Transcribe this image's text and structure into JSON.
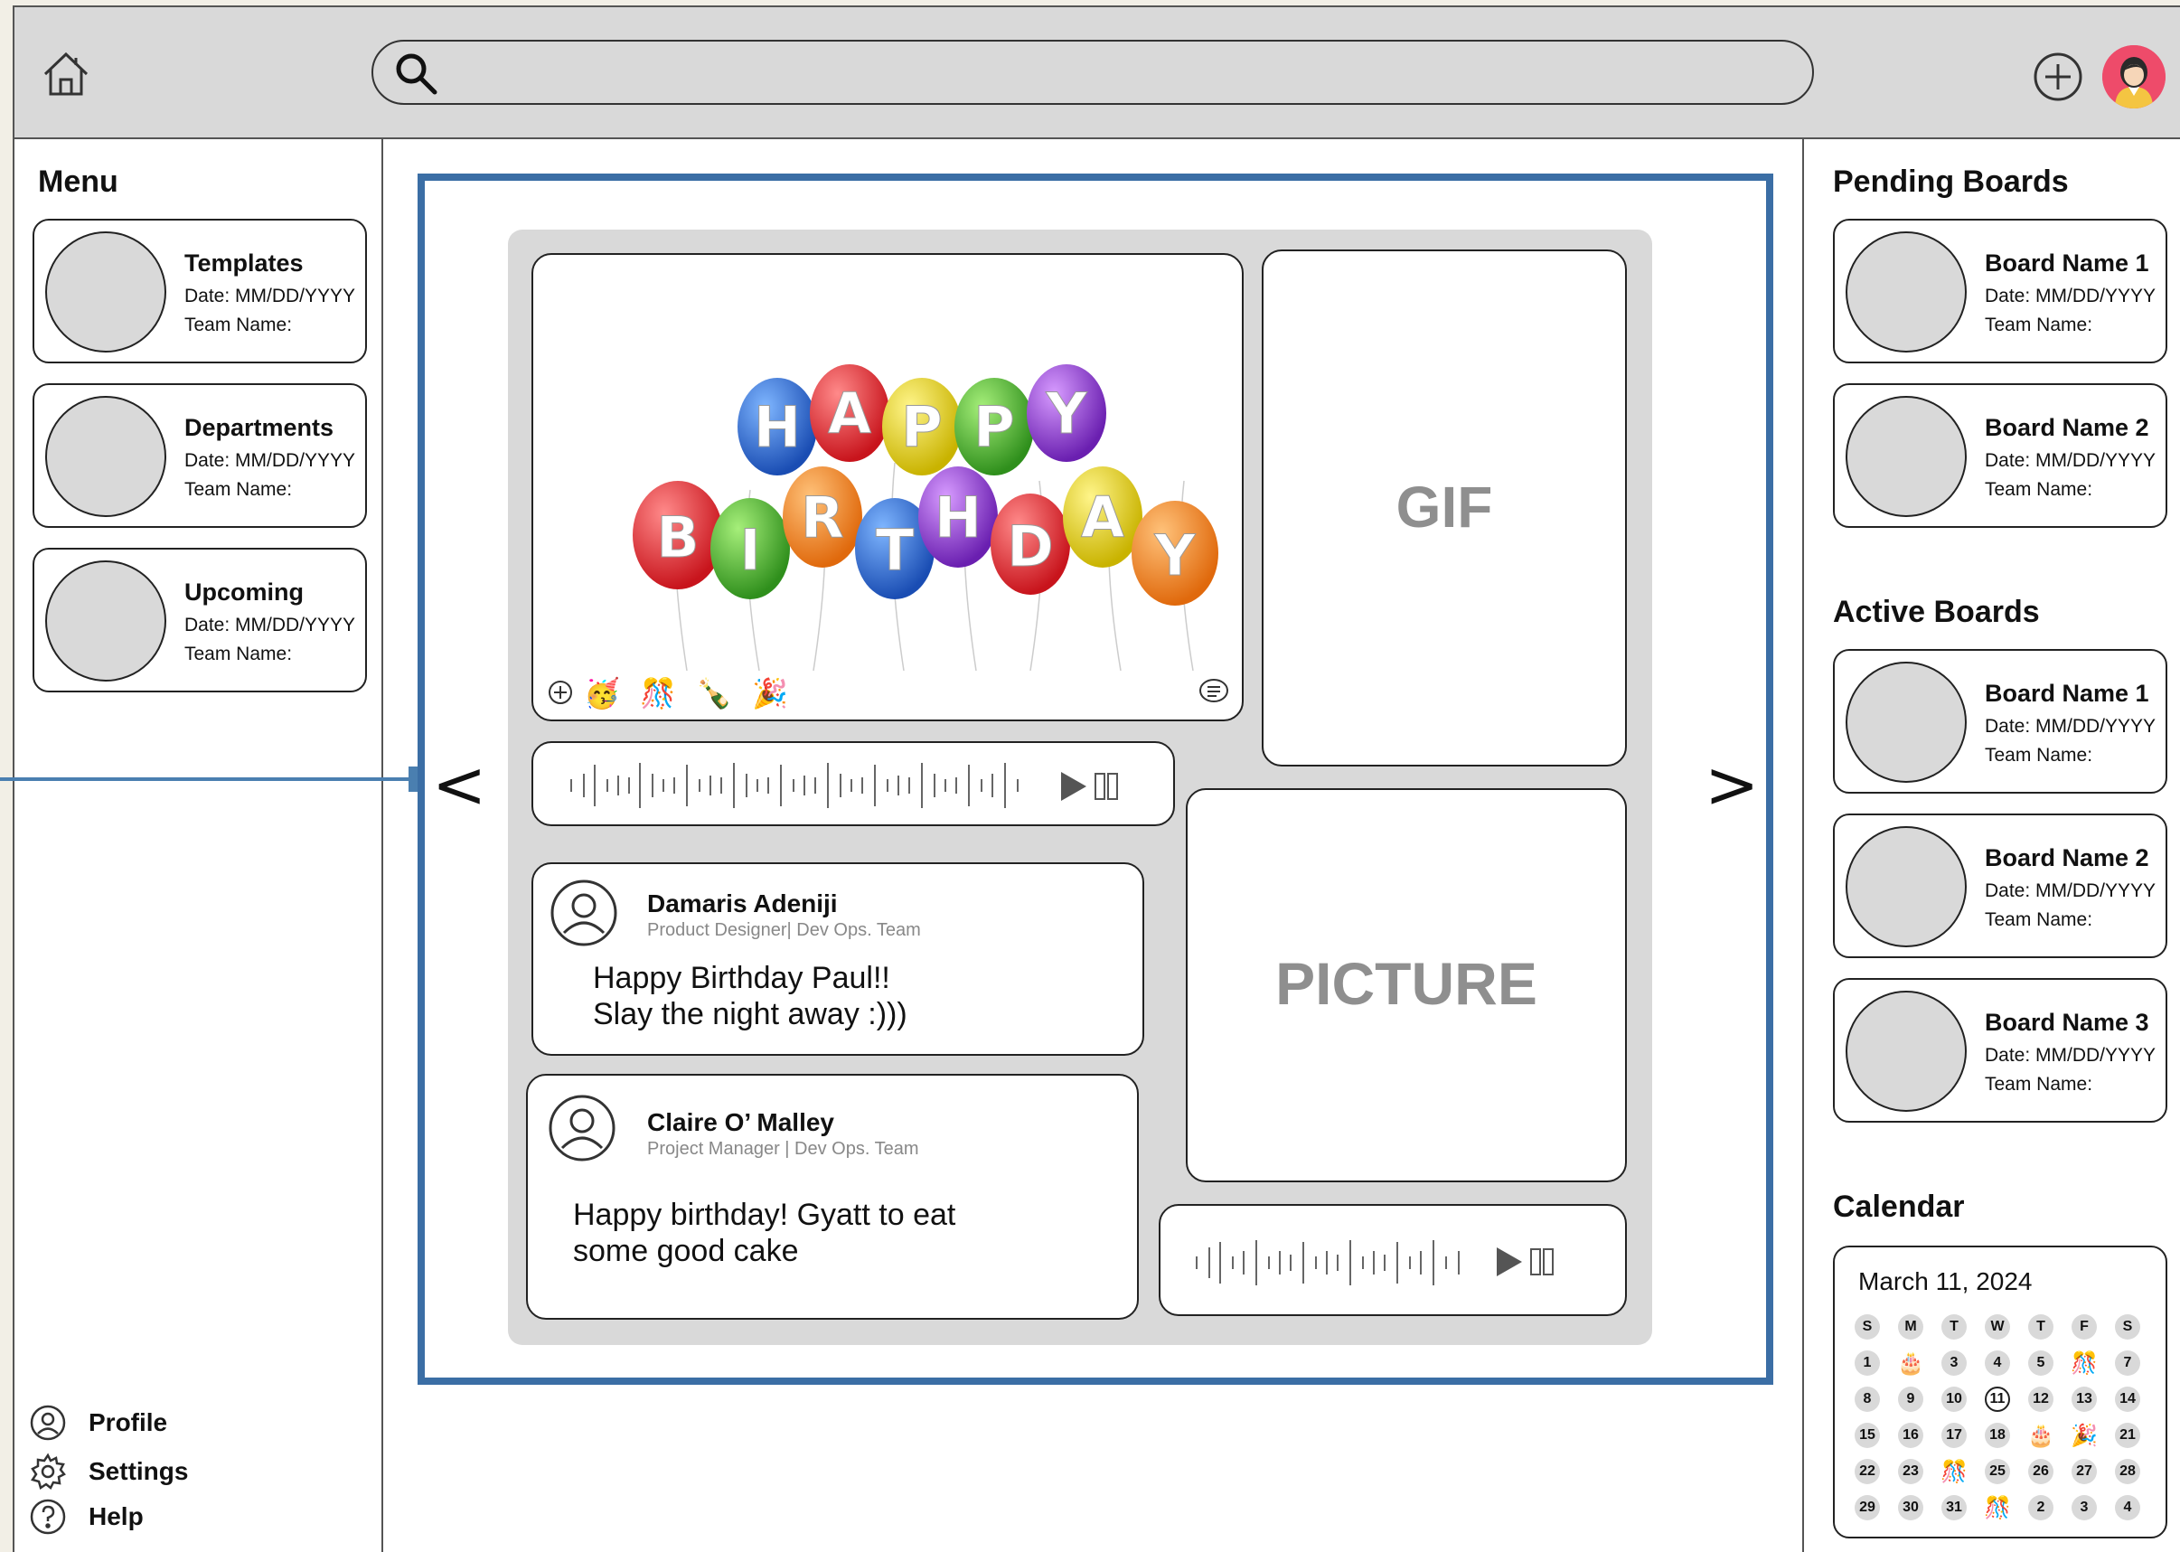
{
  "search": {
    "placeholder": ""
  },
  "sidebar": {
    "title": "Menu",
    "cards": [
      {
        "title": "Templates",
        "date": "Date: MM/DD/YYYY",
        "team": "Team Name:"
      },
      {
        "title": "Departments",
        "date": "Date: MM/DD/YYYY",
        "team": "Team Name:"
      },
      {
        "title": "Upcoming",
        "date": "Date: MM/DD/YYYY",
        "team": "Team Name:"
      }
    ],
    "links": [
      {
        "label": "Profile",
        "icon": "user-icon"
      },
      {
        "label": "Settings",
        "icon": "gear-icon"
      },
      {
        "label": "Help",
        "icon": "help-icon"
      }
    ]
  },
  "board": {
    "prev_label": "<",
    "next_label": ">",
    "gif_label": "GIF",
    "picture_label": "PICTURE",
    "balloon_letters_top": [
      "H",
      "A",
      "P",
      "P",
      "Y"
    ],
    "balloon_letters_bottom": [
      "B",
      "I",
      "R",
      "T",
      "H",
      "D",
      "A",
      "Y"
    ],
    "reactions": [
      "🥳",
      "🎊",
      "🍾",
      "🎉"
    ],
    "messages": [
      {
        "name": "Damaris Adeniji",
        "role": "Product Designer| Dev Ops. Team",
        "text_line1": "Happy Birthday Paul!!",
        "text_line2": "Slay the night away :)))"
      },
      {
        "name": "Claire O’ Malley",
        "role": "Project Manager | Dev Ops. Team",
        "text_line1": "Happy birthday! Gyatt to eat",
        "text_line2": "some good cake"
      }
    ]
  },
  "pending": {
    "title": "Pending Boards",
    "cards": [
      {
        "title": "Board Name 1",
        "date": "Date: MM/DD/YYYY",
        "team": "Team Name:"
      },
      {
        "title": "Board Name 2",
        "date": "Date: MM/DD/YYYY",
        "team": "Team Name:"
      }
    ]
  },
  "active": {
    "title": "Active Boards",
    "cards": [
      {
        "title": "Board Name 1",
        "date": "Date: MM/DD/YYYY",
        "team": "Team Name:"
      },
      {
        "title": "Board Name 2",
        "date": "Date: MM/DD/YYYY",
        "team": "Team Name:"
      },
      {
        "title": "Board Name 3",
        "date": "Date: MM/DD/YYYY",
        "team": "Team Name:"
      }
    ]
  },
  "calendar": {
    "title": "Calendar",
    "date_label": "March 11, 2024",
    "weekdays": [
      "S",
      "M",
      "T",
      "W",
      "T",
      "F",
      "S"
    ],
    "days": [
      "1",
      "🎂",
      "3",
      "4",
      "5",
      "🎊",
      "7",
      "8",
      "9",
      "10",
      "11",
      "12",
      "13",
      "14",
      "15",
      "16",
      "17",
      "18",
      "🎂",
      "🎉",
      "21",
      "22",
      "23",
      "🎊",
      "25",
      "26",
      "27",
      "28",
      "29",
      "30",
      "31",
      "🎊",
      "2",
      "3",
      "4"
    ],
    "today": "11"
  }
}
